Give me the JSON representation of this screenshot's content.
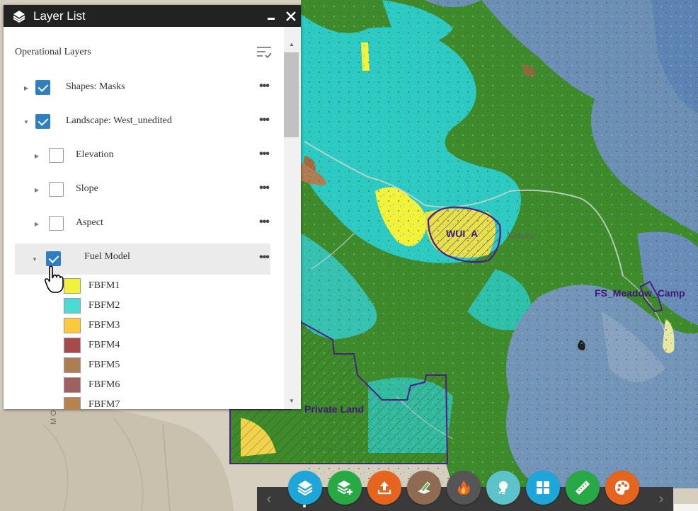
{
  "map": {
    "labels": {
      "wui": "WUI_A",
      "nelson": "Nelson",
      "meadow_camp": "FS_Meadow_Camp",
      "private_land": "Private Land",
      "mountain": "MOUNTAIN"
    }
  },
  "layer_panel": {
    "title": "Layer List",
    "section_title": "Operational Layers",
    "layers": [
      {
        "label": "Shapes: Masks",
        "checked": true,
        "expanded": false
      },
      {
        "label": "Landscape: West_unedited",
        "checked": true,
        "expanded": true
      },
      {
        "label": "Elevation",
        "checked": false,
        "expanded": false
      },
      {
        "label": "Slope",
        "checked": false,
        "expanded": false
      },
      {
        "label": "Aspect",
        "checked": false,
        "expanded": false
      },
      {
        "label": "Fuel Model",
        "checked": true,
        "expanded": true
      }
    ],
    "legend": [
      {
        "label": "FBFM1",
        "color": "#f2f23a"
      },
      {
        "label": "FBFM2",
        "color": "#4dd9d4"
      },
      {
        "label": "FBFM3",
        "color": "#ffc83d"
      },
      {
        "label": "FBFM4",
        "color": "#a84a4a"
      },
      {
        "label": "FBFM5",
        "color": "#b07d53"
      },
      {
        "label": "FBFM6",
        "color": "#a0605e"
      },
      {
        "label": "FBFM7",
        "color": "#b8834d"
      }
    ]
  },
  "toolbar": {
    "buttons": [
      {
        "name": "layer-list-button",
        "icon": "layers-icon",
        "color": "#1ea6d8"
      },
      {
        "name": "add-data-button",
        "icon": "add-layer-icon",
        "color": "#28a946"
      },
      {
        "name": "upload-button",
        "icon": "upload-icon",
        "color": "#e5651f"
      },
      {
        "name": "edit-button",
        "icon": "edit-map-icon",
        "color": "#8e6b52"
      },
      {
        "name": "fire-button",
        "icon": "fire-icon",
        "color": "#555555"
      },
      {
        "name": "idea-button",
        "icon": "lightbulb-icon",
        "color": "#5bc3c9"
      },
      {
        "name": "grid-button",
        "icon": "grid-icon",
        "color": "#1ea6d8"
      },
      {
        "name": "measure-button",
        "icon": "ruler-icon",
        "color": "#28a946"
      },
      {
        "name": "palette-button",
        "icon": "palette-icon",
        "color": "#e5651f"
      }
    ]
  },
  "colors": {
    "forest_green": "#3f8a2a",
    "teal": "#2dc9c3",
    "blue_gray": "#6e8fb5",
    "yellow": "#f2f23a",
    "purple_boundary": "#4b1f86"
  }
}
